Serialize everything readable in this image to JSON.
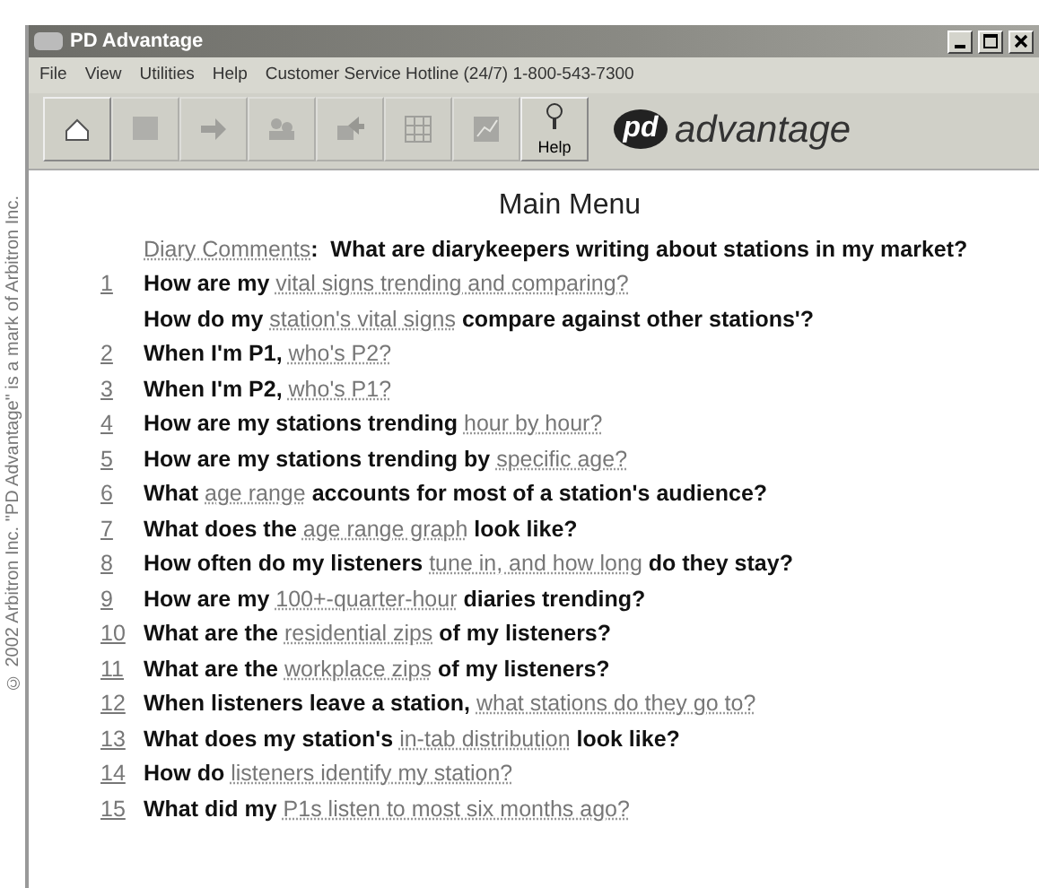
{
  "side_note": "© 2002 Arbitron Inc. \"PD Advantage\" is a mark of Arbitron Inc.",
  "window": {
    "title": "PD Advantage"
  },
  "menu": [
    "File",
    "View",
    "Utilities",
    "Help",
    "Customer Service Hotline (24/7) 1-800-543-7300"
  ],
  "toolbar": [
    {
      "kind": "home",
      "disabled": false
    },
    {
      "kind": "blank",
      "disabled": true
    },
    {
      "kind": "arrow",
      "disabled": true
    },
    {
      "kind": "people",
      "disabled": true
    },
    {
      "kind": "export",
      "disabled": true
    },
    {
      "kind": "grid",
      "disabled": true
    },
    {
      "kind": "chart",
      "disabled": true
    },
    {
      "kind": "help",
      "label": "Help",
      "disabled": false
    }
  ],
  "brand": {
    "badge": "pd",
    "name": "advantage"
  },
  "heading": "Main Menu",
  "items": [
    {
      "parts": [
        {
          "text": "Diary Comments",
          "link": true
        },
        {
          "text": ":  What are diarykeepers writing about stations in my market?",
          "link": false
        }
      ]
    },
    {
      "number": "1",
      "parts": [
        {
          "text": "How are my ",
          "link": false
        },
        {
          "text": "vital signs trending and comparing?",
          "link": true
        }
      ]
    },
    {
      "parts": [
        {
          "text": "How do my ",
          "link": false
        },
        {
          "text": "station's vital signs",
          "link": true
        },
        {
          "text": " compare against other stations'?",
          "link": false
        }
      ]
    },
    {
      "number": "2",
      "parts": [
        {
          "text": "When I'm P1, ",
          "link": false
        },
        {
          "text": "who's P2?",
          "link": true
        }
      ]
    },
    {
      "number": "3",
      "parts": [
        {
          "text": "When I'm P2, ",
          "link": false
        },
        {
          "text": "who's P1?",
          "link": true
        }
      ]
    },
    {
      "number": "4",
      "parts": [
        {
          "text": "How are my stations trending ",
          "link": false
        },
        {
          "text": "hour by hour?",
          "link": true
        }
      ]
    },
    {
      "number": "5",
      "parts": [
        {
          "text": "How are my stations trending by ",
          "link": false
        },
        {
          "text": "specific age?",
          "link": true
        }
      ]
    },
    {
      "number": "6",
      "parts": [
        {
          "text": "What ",
          "link": false
        },
        {
          "text": "age range",
          "link": true
        },
        {
          "text": " accounts for most of a station's audience?",
          "link": false
        }
      ]
    },
    {
      "number": "7",
      "parts": [
        {
          "text": "What does the ",
          "link": false
        },
        {
          "text": "age range graph",
          "link": true
        },
        {
          "text": " look like?",
          "link": false
        }
      ]
    },
    {
      "number": "8",
      "parts": [
        {
          "text": "How often do my listeners ",
          "link": false
        },
        {
          "text": "tune in, and how long",
          "link": true
        },
        {
          "text": " do they stay?",
          "link": false
        }
      ]
    },
    {
      "number": "9",
      "parts": [
        {
          "text": "How are my ",
          "link": false
        },
        {
          "text": "100+-quarter-hour",
          "link": true
        },
        {
          "text": " diaries trending?",
          "link": false
        }
      ]
    },
    {
      "number": "10",
      "parts": [
        {
          "text": "What are the ",
          "link": false
        },
        {
          "text": "residential zips",
          "link": true
        },
        {
          "text": " of my listeners?",
          "link": false
        }
      ]
    },
    {
      "number": "11",
      "parts": [
        {
          "text": "What are the ",
          "link": false
        },
        {
          "text": "workplace zips",
          "link": true
        },
        {
          "text": " of my listeners?",
          "link": false
        }
      ]
    },
    {
      "number": "12",
      "parts": [
        {
          "text": "When listeners leave a station, ",
          "link": false
        },
        {
          "text": "what stations do they go to?",
          "link": true
        }
      ]
    },
    {
      "number": "13",
      "parts": [
        {
          "text": "What does my station's ",
          "link": false
        },
        {
          "text": "in-tab distribution",
          "link": true
        },
        {
          "text": " look like?",
          "link": false
        }
      ]
    },
    {
      "number": "14",
      "parts": [
        {
          "text": "How do ",
          "link": false
        },
        {
          "text": "listeners identify my station?",
          "link": true
        }
      ]
    },
    {
      "number": "15",
      "parts": [
        {
          "text": "What did my ",
          "link": false
        },
        {
          "text": "P1s listen to most six months ago?",
          "link": true
        }
      ]
    }
  ]
}
